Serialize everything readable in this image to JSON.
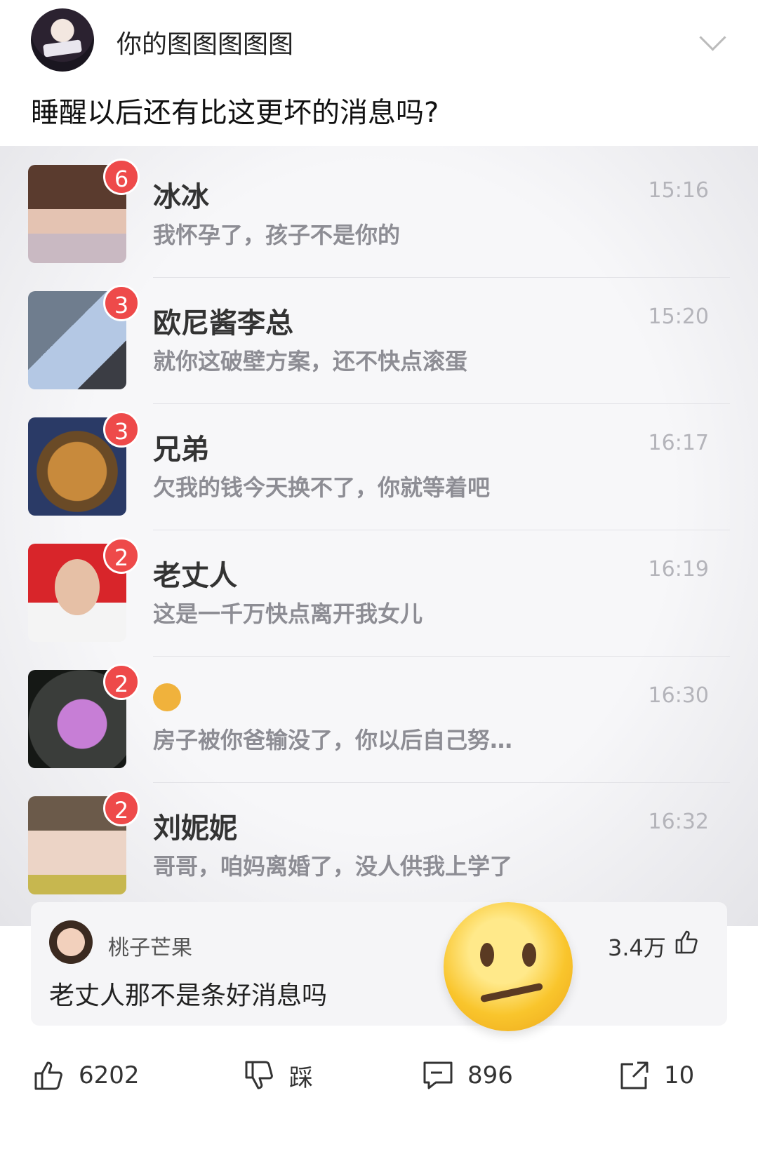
{
  "header": {
    "username": "你的图图图图图"
  },
  "post": {
    "text": "睡醒以后还有比这更坏的消息吗?"
  },
  "chat_list": [
    {
      "name": "冰冰",
      "message": "我怀孕了，孩子不是你的",
      "time": "15:16",
      "badge": "6"
    },
    {
      "name": "欧尼酱李总",
      "message": "就你这破壁方案，还不快点滚蛋",
      "time": "15:20",
      "badge": "3"
    },
    {
      "name": "兄弟",
      "message": "欠我的钱今天换不了，你就等着吧",
      "time": "16:17",
      "badge": "3"
    },
    {
      "name": "老丈人",
      "message": "这是一千万快点离开我女儿",
      "time": "16:19",
      "badge": "2"
    },
    {
      "name": "",
      "message": "房子被你爸输没了，你以后自己努…",
      "time": "16:30",
      "badge": "2"
    },
    {
      "name": "刘妮妮",
      "message": "哥哥，咱妈离婚了，没人供我上学了",
      "time": "16:32",
      "badge": "2"
    }
  ],
  "comment": {
    "user": "桃子芒果",
    "text": "老丈人那不是条好消息吗",
    "likes": "3.4万"
  },
  "actions": {
    "like_count": "6202",
    "dislike_label": "踩",
    "comment_count": "896",
    "share_count": "10"
  }
}
